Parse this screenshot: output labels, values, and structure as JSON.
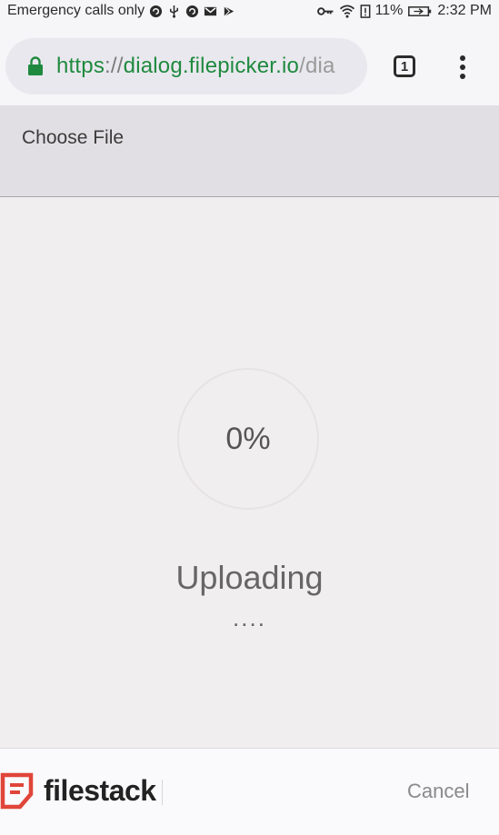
{
  "status_bar": {
    "carrier_text": "Emergency calls only",
    "battery_percent": "11%",
    "time": "2:32 PM",
    "icons_left": [
      "sync-icon",
      "usb-icon",
      "sync-icon",
      "gmail-icon",
      "play-store-icon"
    ],
    "icons_right": [
      "key-icon",
      "wifi-icon",
      "battery-alert-icon",
      "battery-icon"
    ]
  },
  "browser": {
    "url_scheme": "https",
    "url_separator": "://",
    "url_host": "dialog.filepicker.io",
    "url_path": "/dia",
    "tab_count": "1",
    "secure_color": "#1f8a3f"
  },
  "header": {
    "title": "Choose File"
  },
  "upload": {
    "progress_label": "0%",
    "progress_value": 0,
    "status_label": "Uploading",
    "dots": "...."
  },
  "footer": {
    "brand": "filestack",
    "brand_color": "#e0453a",
    "cancel_label": "Cancel"
  }
}
